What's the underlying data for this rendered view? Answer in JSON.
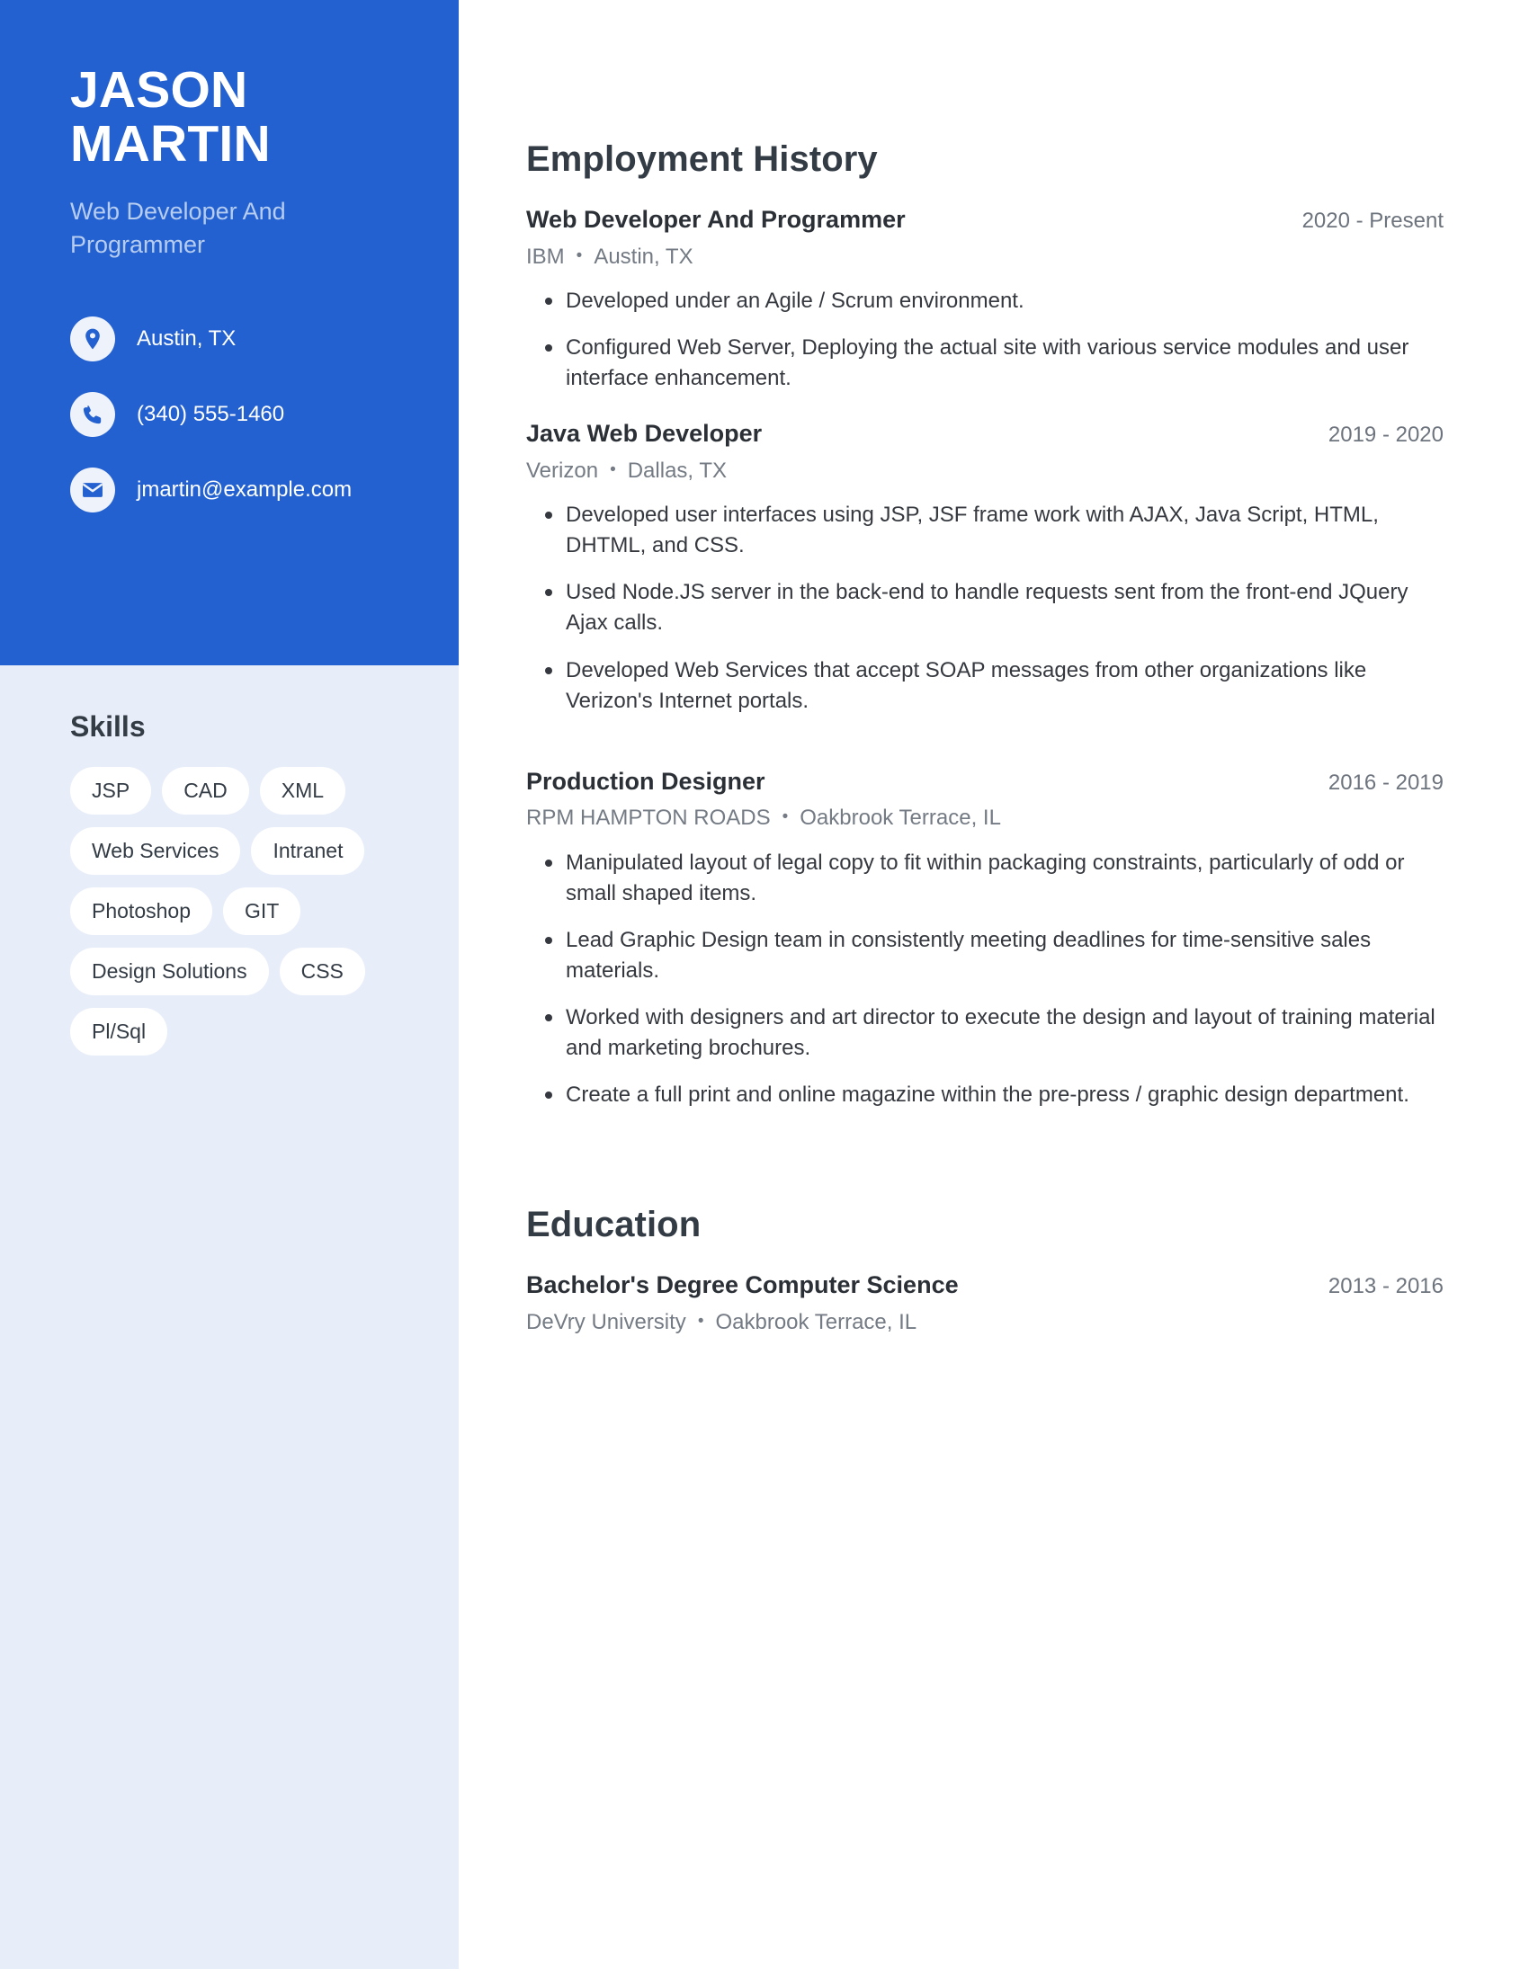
{
  "sidebar": {
    "first_name": "JASON",
    "last_name": "MARTIN",
    "role": "Web Developer And Programmer",
    "contacts": [
      {
        "icon": "location-pin-icon",
        "value": "Austin, TX"
      },
      {
        "icon": "phone-icon",
        "value": "(340) 555-1460"
      },
      {
        "icon": "envelope-icon",
        "value": "jmartin@example.com"
      }
    ],
    "skills_title": "Skills",
    "skills": [
      "JSP",
      "CAD",
      "XML",
      "Web Services",
      "Intranet",
      "Photoshop",
      "GIT",
      "Design Solutions",
      "CSS",
      "Pl/Sql"
    ]
  },
  "main": {
    "employment_title": "Employment History",
    "education_title": "Education",
    "separator": "•",
    "jobs": [
      {
        "title": "Web Developer And Programmer",
        "date": "2020 - Present",
        "company": "IBM",
        "location": "Austin, TX",
        "bullets": [
          "Developed under an Agile / Scrum environment.",
          "Configured Web Server, Deploying the actual site with various service modules and user interface enhancement."
        ]
      },
      {
        "title": "Java Web Developer",
        "date": "2019 - 2020",
        "company": "Verizon",
        "location": "Dallas, TX",
        "bullets": [
          "Developed user interfaces using JSP, JSF frame work with AJAX, Java Script, HTML, DHTML, and CSS.",
          "Used Node.JS server in the back-end to handle requests sent from the front-end JQuery Ajax calls.",
          "Developed Web Services that accept SOAP messages from other organizations like Verizon's Internet portals."
        ]
      },
      {
        "title": "Production Designer",
        "date": "2016 - 2019",
        "company": "RPM HAMPTON ROADS",
        "location": "Oakbrook Terrace, IL",
        "bullets": [
          "Manipulated layout of legal copy to fit within packaging constraints, particularly of odd or small shaped items.",
          "Lead Graphic Design team in consistently meeting deadlines for time-sensitive sales materials.",
          "Worked with designers and art director to execute the design and layout of training material and marketing brochures.",
          "Create a full print and online magazine within the pre-press / graphic design department."
        ]
      }
    ],
    "education": [
      {
        "title": "Bachelor's Degree Computer Science",
        "date": "2013 - 2016",
        "school": "DeVry University",
        "location": "Oakbrook Terrace, IL"
      }
    ]
  },
  "colors": {
    "accent_blue": "#2360d0",
    "sidebar_panel": "#e8eef9",
    "role_text": "#b6cdf0",
    "heading_text": "#333b45",
    "body_text": "#35393f",
    "muted_text": "#747b84"
  }
}
